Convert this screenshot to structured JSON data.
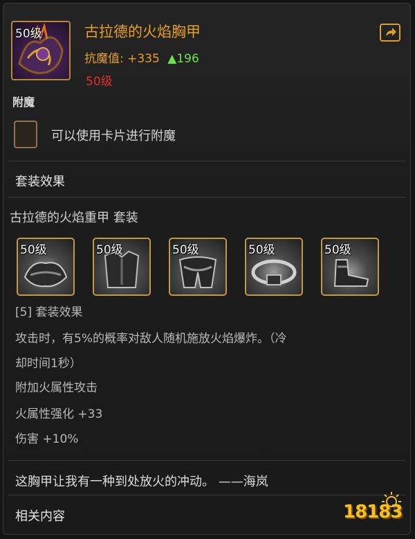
{
  "item": {
    "level_tag": "50级",
    "name": "古拉德的火焰胸甲",
    "stat_label": "抗魔值:",
    "stat_value": "+335",
    "stat_delta": "▲196",
    "required_level": "50级",
    "icon": "flame-chest-armor-icon"
  },
  "enchant": {
    "label": "附魔",
    "slot_text": "可以使用卡片进行附魔"
  },
  "set": {
    "header": "套装效果",
    "name": "古拉德的火焰重甲  套装",
    "pieces": [
      {
        "level": "50级",
        "icon": "shoulder-armor-icon"
      },
      {
        "level": "50级",
        "icon": "chest-armor-icon"
      },
      {
        "level": "50级",
        "icon": "leg-armor-icon"
      },
      {
        "level": "50级",
        "icon": "belt-icon"
      },
      {
        "level": "50级",
        "icon": "boots-icon"
      }
    ],
    "effects": [
      "[5] 套装效果",
      "攻击时，有5%的概率对敌人随机施放火焰爆炸。（冷",
      "却时间1秒）",
      "附加火属性攻击",
      "火属性强化 +33",
      "伤害 +10%"
    ]
  },
  "flavor": "这胸甲让我有一种到处放火的冲动。  ——海岚",
  "related": "相关内容",
  "watermark": "18183",
  "colors": {
    "title": "#e8a020",
    "delta_up": "#6ee04a",
    "required_level": "#e23030",
    "frame_gold": "#c19a45"
  }
}
